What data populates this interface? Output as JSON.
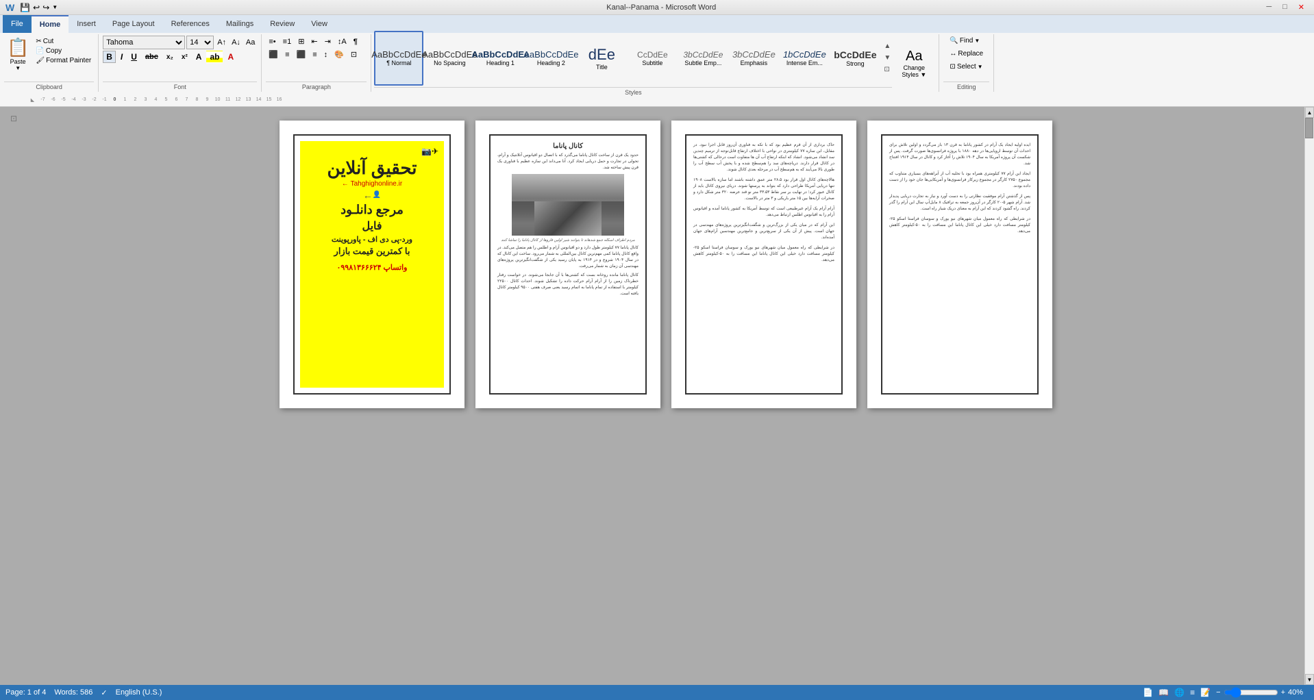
{
  "titlebar": {
    "title": "Kanal--Panama - Microsoft Word",
    "min_btn": "─",
    "restore_btn": "□",
    "close_btn": "✕",
    "quickaccess": [
      "💾",
      "↩",
      "↪"
    ]
  },
  "ribbon": {
    "tabs": [
      "File",
      "Home",
      "Insert",
      "Page Layout",
      "References",
      "Mailings",
      "Review",
      "View"
    ],
    "active_tab": "Home",
    "groups": {
      "clipboard": {
        "label": "Clipboard",
        "paste_label": "Paste",
        "cut_label": "Cut",
        "copy_label": "Copy",
        "format_painter_label": "Format Painter"
      },
      "font": {
        "label": "Font",
        "font_name": "Tahoma",
        "font_size": "14",
        "bold": "B",
        "italic": "I",
        "underline": "U",
        "strikethrough": "abc",
        "subscript": "x₂",
        "superscript": "x²",
        "font_color_label": "A",
        "highlight_label": "ab"
      },
      "paragraph": {
        "label": "Paragraph"
      },
      "styles": {
        "label": "Styles",
        "items": [
          {
            "id": "normal",
            "label": "¶ Normal",
            "preview": "AaBbCcDdEe",
            "class": "sn-normal",
            "active": true
          },
          {
            "id": "no-spacing",
            "label": "No Spacing",
            "preview": "AaBbCcDdEe",
            "class": "sn-nospacing"
          },
          {
            "id": "heading1",
            "label": "Heading 1",
            "preview": "AaBbCcDdEe",
            "class": "sn-h1"
          },
          {
            "id": "heading2",
            "label": "Heading 2",
            "preview": "AaBbCcDdEe",
            "class": "sn-h2"
          },
          {
            "id": "title",
            "label": "Title",
            "preview": "dEe",
            "class": "sn-title"
          },
          {
            "id": "subtitle",
            "label": "Subtitle",
            "preview": "CcDdEe",
            "class": "sn-subtitle"
          },
          {
            "id": "subtle-emp",
            "label": "Subtle Emp...",
            "preview": "3bCcDdEe",
            "class": "sn-subtle"
          },
          {
            "id": "emphasis",
            "label": "Emphasis",
            "preview": "3bCcDdEe",
            "class": "sn-emphasis"
          },
          {
            "id": "intense-emp",
            "label": "Intense Em...",
            "preview": "1bCcDdEe",
            "class": "sn-intense"
          },
          {
            "id": "strong",
            "label": "Strong",
            "preview": "bCcDdEe",
            "class": "sn-strong"
          }
        ],
        "change_styles_label": "Change\nStyles"
      },
      "editing": {
        "label": "Editing",
        "find_label": "Find",
        "replace_label": "Replace",
        "select_label": "Select"
      }
    }
  },
  "ruler": {
    "marks": [
      "-7",
      "-6",
      "-5",
      "-4",
      "-3",
      "-2",
      "-1",
      "0",
      "1",
      "2",
      "3",
      "4",
      "5",
      "6",
      "7",
      "8",
      "9",
      "10",
      "11",
      "12",
      "13",
      "14",
      "15",
      "16"
    ]
  },
  "pages": [
    {
      "id": "page1",
      "type": "cover",
      "border": true,
      "yellow_bg": true,
      "title_fa": "تحقیق آنلاین",
      "site_url": "Tahghighonline.ir",
      "desc1": "مرجع دانلود",
      "desc2": "فایل",
      "desc3": "ورد-پی دی اف - پاورپوینت",
      "desc4": "با کمترین قیمت بازار",
      "phone": "واتساپ 09981366624"
    },
    {
      "id": "page2",
      "type": "text",
      "title": "کانال پاناما",
      "has_image": true,
      "image_caption": "مردم اطراف اسکله جمع شدهاند تا بتوانند شیر اولین فاروها از کانال پاناما را تماشا کنند",
      "paragraphs": [
        "حدود یک قرن از ساخت کانال پاناما می‌گذرد که با اتصال دو اقیانوس آتلانتیک و آرام، تحولی در تجارت و حمل دریایی ایجاد کرد. آنا می‌داند این سازه عظیم با فناوری‌یک قرن پیش ساخته شد.",
        "کانال پاناما ۷۷ کیلومتر طول دارد و دو اقیانوس آرام و اطلس را هم متصل می‌کند. در واقع کانال پاناما کمی مهم‌ترین کانال بین‌المللی به شمار می‌رود. ساخت این کانال که در سال ۱۹۰۴ شروع و در ۱۹۱۴ به پایان رسید، یکی از شگفت‌انگیزترین پروژه‌های مهندسی آن زمان به شمار می‌رفت."
      ]
    },
    {
      "id": "page3",
      "type": "text",
      "paragraphs": [
        "حاک برداری از آن قرم عظیم بود که با تکه به فناوری آن‌روز قابل اجرا نبود. در مقابل، ابن سازه ۷۷ کیلومتری در نواحی با اختلاف ارتفاع قابل‌توجه از ترمیم چندین سد انشاد شد انشاد که ابنکه ارتفاع آب آن ها متفاوت است درحالی که کشتی‌ها از کانال قرار دارند. دریاچه‌های سد را هم‌سطح شده و با پخش آب سطح آب را طوری بالا می‌آیند که به هم‌سطح آب در مرحله بعدی کانال شوند.",
        "هالاچه‌های کانال اول قرار بود ۲۸.۵ متر عمق داشته باشند اما سازه ۱۹۰۸ تنها دریایی آمریکا طراحی دارد ۳۲ متر با ترستها شوند. دریای نیروی کانال باید از کانال عبور کرد؛ در نهایت بر سر نقاط ۳۳.۵۳ متر نو قند عرضه ۳۲۰ متر شکل دارد و صخرات آرایه‌ها بین ۱۵ متر باریکی و ۳ متر در بالاست.",
        "آرام آرام یک آرام غیرطبیعی است که توسط آمریکا به کشور پاناما آمده و اقیانوس آرام را به اقیانوس اطلس ارتباط می‌دهد.",
        "این آرام که در میان یکی از بزرگ‌ترین و شگفت‌انگیزترین پروژه‌های مهندسی در جهان است."
      ]
    },
    {
      "id": "page4",
      "type": "text",
      "paragraphs": [
        "ایده اولیه ایجاد یک آرام در کشور پاناما به قرن ۱۳ باز می‌گردد و اولین تلاش برای احداث آن توسط اروپایی‌ها در دهه ۱۸۸۰ با پروژه فرانسوی‌ها صورت گرفت. پس از شکست آن پروژه آمریکا به سال ۱۹۰۴ تلاش را آغاز کرد و کانال در سال ۱۹۱۴ افتتاح شد.",
        "ایجاد این آرام ۷۷ کیلومتری همراه بود با تخلیه آب از آبراهه‌های بسیاری متناوب که مجموع ۲۷۵۰ کارگر در مجموع زیرکار فرانسوی‌ها و آمریکایی‌ها جان خود را از دست داده بودند.",
        "پس از گذشتن آرام موفقیت نظارتی را به دست آورد و نیاز به تجارت دریایی پدیدار شد. آرام شهر ۵-۲۰ کارگر در آن‌روز جمعه به ترافیک ۸ مایل‌آپ سال این آرام را گذر کردند. راه گشود کردند که این آرام به معنای دریک شیار راه است.",
        "در شرایطی که راه معمول میان شهرهای نیو یورک و سوسان فراستا اسکو ۲۵-کیلومتر مسافت دارد خیلی این کانال پاناما این مسافت را به ۵۰-کیلومتر کاهش می‌دهد."
      ]
    }
  ],
  "statusbar": {
    "page_info": "Page: 1 of 4",
    "words_info": "Words: 586",
    "language": "English (U.S.)",
    "zoom": "40%"
  }
}
